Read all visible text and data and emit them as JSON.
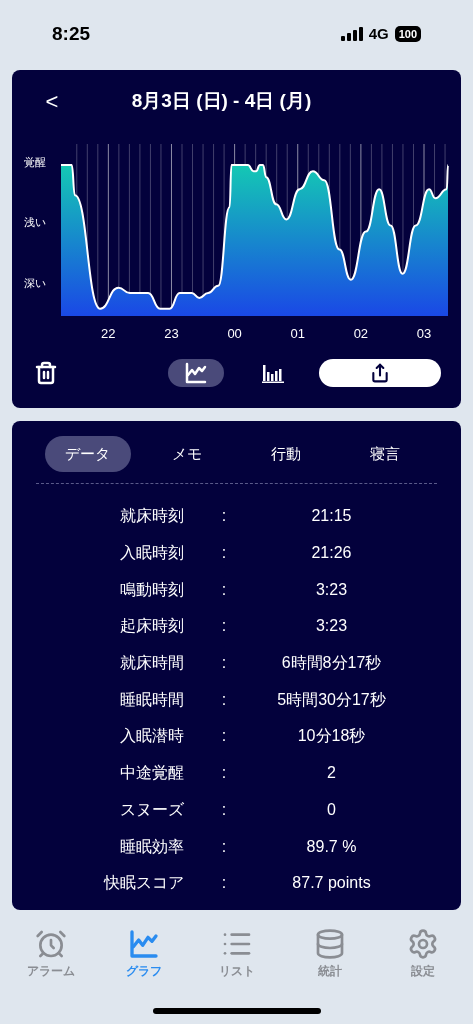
{
  "status_bar": {
    "time": "8:25",
    "network": "4G",
    "battery": "100"
  },
  "header": {
    "back": "<",
    "title": "8月3日 (日) - 4日 (月)"
  },
  "sleep_chart": {
    "y_labels": [
      "覚醒",
      "浅い",
      "深い"
    ],
    "x_labels": [
      "22",
      "23",
      "00",
      "01",
      "02",
      "03"
    ]
  },
  "view_toggle": [
    {
      "kind": "line",
      "selected": true
    },
    {
      "kind": "bar",
      "selected": false
    }
  ],
  "tabs": [
    {
      "label": "データ",
      "selected": true
    },
    {
      "label": "メモ",
      "selected": false
    },
    {
      "label": "行動",
      "selected": false
    },
    {
      "label": "寝言",
      "selected": false
    }
  ],
  "data_rows": [
    {
      "label": "就床時刻",
      "separator": ":",
      "value": "21:15"
    },
    {
      "label": "入眠時刻",
      "separator": ":",
      "value": "21:26"
    },
    {
      "label": "鳴動時刻",
      "separator": ":",
      "value": "3:23"
    },
    {
      "label": "起床時刻",
      "separator": ":",
      "value": "3:23"
    },
    {
      "label": "就床時間",
      "separator": ":",
      "value": "6時間8分17秒"
    },
    {
      "label": "睡眠時間",
      "separator": ":",
      "value": "5時間30分17秒"
    },
    {
      "label": "入眠潜時",
      "separator": ":",
      "value": "10分18秒"
    },
    {
      "label": "中途覚醒",
      "separator": ":",
      "value": "2"
    },
    {
      "label": "スヌーズ",
      "separator": ":",
      "value": "0"
    },
    {
      "label": "睡眠効率",
      "separator": ":",
      "value": "89.7 %"
    },
    {
      "label": "快眠スコア",
      "separator": ":",
      "value": "87.7 points"
    }
  ],
  "tab_bar": [
    {
      "kind": "alarm",
      "label": "アラーム",
      "selected": false
    },
    {
      "kind": "graph",
      "label": "グラフ",
      "selected": true
    },
    {
      "kind": "list",
      "label": "リスト",
      "selected": false
    },
    {
      "kind": "stats",
      "label": "統計",
      "selected": false
    },
    {
      "kind": "settings",
      "label": "設定",
      "selected": false
    }
  ]
}
